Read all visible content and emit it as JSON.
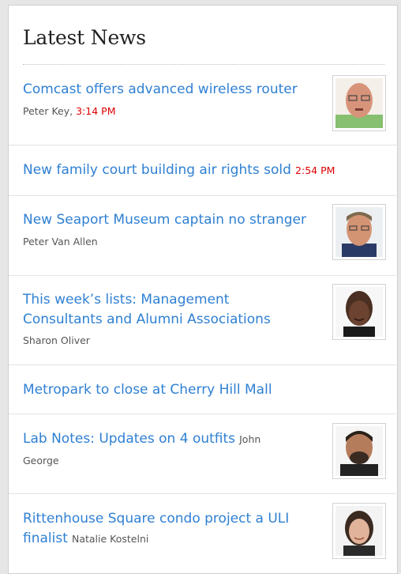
{
  "widget": {
    "title": "Latest News"
  },
  "items": [
    {
      "headline": "Comcast offers advanced wireless router",
      "author": "Peter Key,",
      "time": "3:14 PM",
      "has_photo": true
    },
    {
      "headline": "New family court building air rights sold",
      "author": "",
      "time": "2:54 PM",
      "has_photo": false
    },
    {
      "headline": "New Seaport Museum captain no stranger",
      "author": "Peter Van Allen",
      "time": "",
      "has_photo": true
    },
    {
      "headline_line1": "This week’s lists: Management",
      "headline_line2": "Consultants and Alumni Associations",
      "author": "Sharon Oliver",
      "time": "",
      "has_photo": true
    },
    {
      "headline": "Metropark to close at Cherry Hill Mall",
      "author": "",
      "time": "",
      "has_photo": false
    },
    {
      "headline": "Lab Notes: Updates on 4 outfits",
      "author_part1": "John",
      "author_part2": "George",
      "time": "",
      "has_photo": true
    },
    {
      "headline_line1": "Rittenhouse Square condo project a ULI",
      "headline_line2": "finalist",
      "author": "Natalie Kostelni",
      "time": "",
      "has_photo": true
    }
  ]
}
